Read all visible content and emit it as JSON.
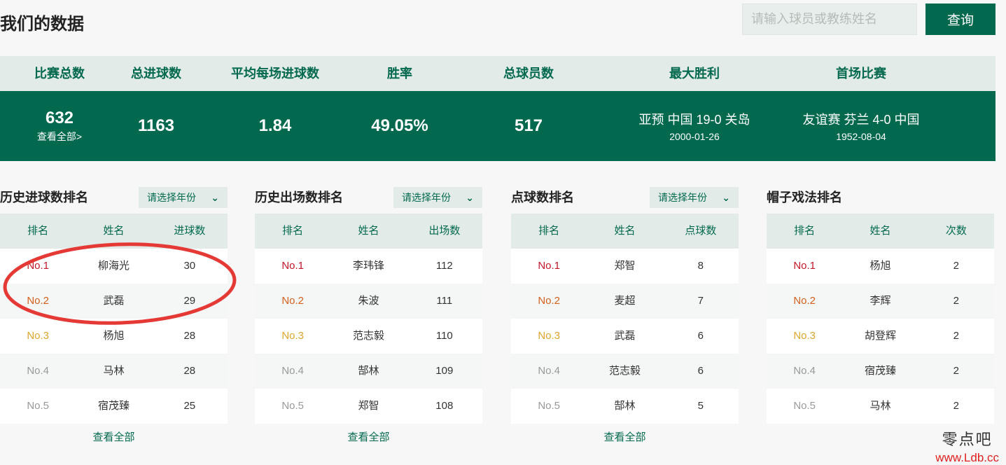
{
  "page": {
    "title": "我们的数据"
  },
  "search": {
    "placeholder": "请输入球员或教练姓名",
    "button_label": "查询"
  },
  "stats": {
    "headers": [
      "比赛总数",
      "总进球数",
      "平均每场进球数",
      "胜率",
      "总球员数",
      "最大胜利",
      "首场比赛"
    ],
    "total_matches": "632",
    "view_all": "查看全部>",
    "total_goals": "1163",
    "avg_goals": "1.84",
    "win_rate": "49.05%",
    "total_players": "517",
    "biggest_win": {
      "match": "亚预 中国 19-0 关岛",
      "date": "2000-01-26"
    },
    "first_match": {
      "match": "友谊赛 芬兰 4-0 中国",
      "date": "1952-08-04"
    }
  },
  "panels": [
    {
      "title": "历史进球数排名",
      "select": "请选择年份",
      "columns": [
        "排名",
        "姓名",
        "进球数"
      ],
      "rows": [
        {
          "rank": "No.1",
          "name": "柳海光",
          "value": "30"
        },
        {
          "rank": "No.2",
          "name": "武磊",
          "value": "29"
        },
        {
          "rank": "No.3",
          "name": "杨旭",
          "value": "28"
        },
        {
          "rank": "No.4",
          "name": "马林",
          "value": "28"
        },
        {
          "rank": "No.5",
          "name": "宿茂臻",
          "value": "25"
        }
      ],
      "view_all": "查看全部"
    },
    {
      "title": "历史出场数排名",
      "select": "请选择年份",
      "columns": [
        "排名",
        "姓名",
        "出场数"
      ],
      "rows": [
        {
          "rank": "No.1",
          "name": "李玮锋",
          "value": "112"
        },
        {
          "rank": "No.2",
          "name": "朱波",
          "value": "111"
        },
        {
          "rank": "No.3",
          "name": "范志毅",
          "value": "110"
        },
        {
          "rank": "No.4",
          "name": "郜林",
          "value": "109"
        },
        {
          "rank": "No.5",
          "name": "郑智",
          "value": "108"
        }
      ],
      "view_all": "查看全部"
    },
    {
      "title": "点球数排名",
      "select": "请选择年份",
      "columns": [
        "排名",
        "姓名",
        "点球数"
      ],
      "rows": [
        {
          "rank": "No.1",
          "name": "郑智",
          "value": "8"
        },
        {
          "rank": "No.2",
          "name": "麦超",
          "value": "7"
        },
        {
          "rank": "No.3",
          "name": "武磊",
          "value": "6"
        },
        {
          "rank": "No.4",
          "name": "范志毅",
          "value": "6"
        },
        {
          "rank": "No.5",
          "name": "郜林",
          "value": "5"
        }
      ],
      "view_all": "查看全部"
    },
    {
      "title": "帽子戏法排名",
      "columns": [
        "排名",
        "姓名",
        "次数"
      ],
      "rows": [
        {
          "rank": "No.1",
          "name": "杨旭",
          "value": "2"
        },
        {
          "rank": "No.2",
          "name": "李辉",
          "value": "2"
        },
        {
          "rank": "No.3",
          "name": "胡登辉",
          "value": "2"
        },
        {
          "rank": "No.4",
          "name": "宿茂臻",
          "value": "2"
        },
        {
          "rank": "No.5",
          "name": "马林",
          "value": "2"
        }
      ]
    }
  ],
  "watermark": {
    "cn": "零点吧",
    "url": "www.Ldb.cc"
  },
  "colors": {
    "brand": "#02694f",
    "rank1": "#c0182a",
    "rank2": "#d3601d",
    "rank3": "#dea62e",
    "annotation": "#e53935"
  }
}
